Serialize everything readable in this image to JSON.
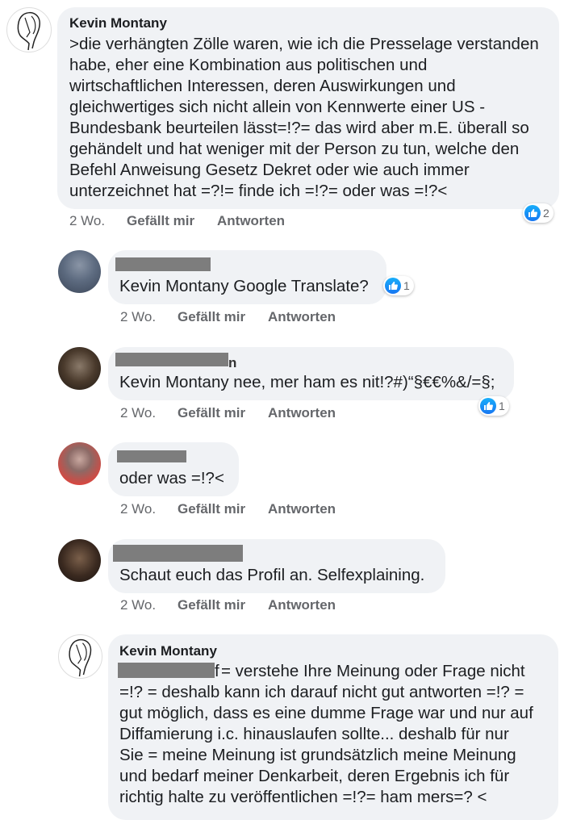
{
  "comments": [
    {
      "author": "Kevin Montany",
      "lines": [
        ">die verhängten Zölle waren, wie ich die Presselage verstanden",
        "habe, eher eine Kombination aus politischen und",
        "wirtschaftlichen Interessen, deren Auswirkungen und",
        "gleichwertiges sich nicht  allein von Kennwerte einer US -",
        "Bundesbank  beurteilen lässt=!?= das wird aber m.E. überall so",
        "gehändelt und hat weniger mit der Person zu tun, welche den",
        "Befehl Anweisung Gesetz Dekret oder wie auch immer",
        "unterzeichnet hat =?!= finde ich =!?= oder was =!?<"
      ],
      "time": "2 Wo.",
      "like": "Gefällt mir",
      "reply": "Antworten",
      "reactions": "2"
    },
    {
      "lines": [
        "Kevin Montany Google Translate?"
      ],
      "time": "2 Wo.",
      "like": "Gefällt mir",
      "reply": "Antworten",
      "reactions": "1"
    },
    {
      "name_fragment": "n",
      "lines": [
        "Kevin Montany nee, mer ham es nit!?#)“§€€%&/=§;"
      ],
      "time": "2 Wo.",
      "like": "Gefällt mir",
      "reply": "Antworten",
      "reactions": "1"
    },
    {
      "lines": [
        "oder was =!?<"
      ],
      "time": "2 Wo.",
      "like": "Gefällt mir",
      "reply": "Antworten"
    },
    {
      "lines": [
        "Schaut euch das Profil an. Selfexplaining."
      ],
      "time": "2 Wo.",
      "like": "Gefällt mir",
      "reply": "Antworten"
    },
    {
      "author": "Kevin Montany",
      "mention_fragment": "f",
      "lines": [
        " = verstehe Ihre Meinung oder Frage nicht",
        "=!? = deshalb kann ich darauf nicht gut antworten =!? =",
        "gut möglich, dass es eine dumme Frage war und nur auf",
        "Diffamierung i.c. hinauslaufen sollte... deshalb für nur",
        "Sie =  meine Meinung ist grundsätzlich meine Meinung",
        "und bedarf meiner Denkarbeit, deren Ergebnis ich für",
        "richtig halte zu veröffentlichen =!?= ham mers=? <"
      ]
    }
  ],
  "colors": {
    "like_blue": "#1877f2",
    "bubble": "#f0f2f5",
    "meta": "#65676b",
    "redaction": "#7d7d7d"
  },
  "icons": {
    "reaction": "thumbs-up-icon",
    "avatar_author": "sketch-face-avatar"
  }
}
